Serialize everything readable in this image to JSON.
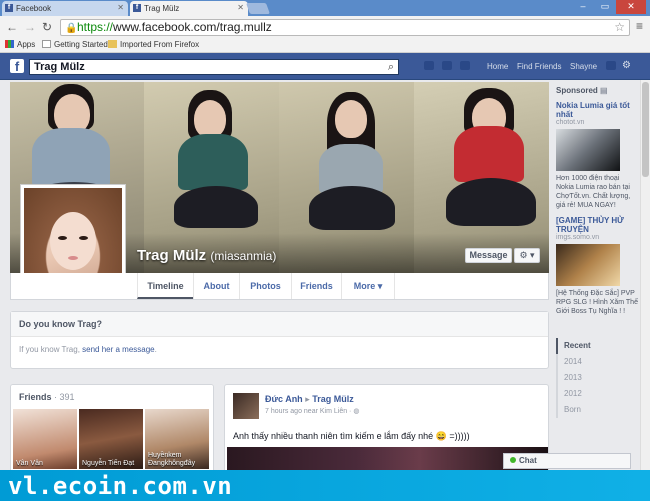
{
  "browser": {
    "tabs": [
      {
        "label": "Facebook",
        "active": false
      },
      {
        "label": "Trag Mülz",
        "active": true
      }
    ],
    "url_scheme": "https://",
    "url_rest": "www.facebook.com/trag.mullz",
    "bookmarks": [
      "Apps",
      "Getting Started",
      "Imported From Firefox"
    ]
  },
  "fb": {
    "search_value": "Trag Mülz",
    "nav": [
      "Home",
      "Find Friends",
      "Shayne"
    ],
    "brand_color": "#3b5998"
  },
  "profile": {
    "name": "Trag Mülz",
    "alt_name": "(miasanmia)",
    "message_label": "Message",
    "gear_label": "⚙ ▾",
    "tabs": [
      "Timeline",
      "About",
      "Photos",
      "Friends",
      "More ▾"
    ]
  },
  "know": {
    "title": "Do you know Trag?",
    "text_prefix": "If you know Trag, ",
    "link": "send her a message",
    "text_suffix": "."
  },
  "friends": {
    "title": "Friends",
    "count": "· 391",
    "people": [
      {
        "caption": "Vân Vân"
      },
      {
        "caption": "Nguyễn Tiến Đạt"
      },
      {
        "caption": "Huyềnkem Đangkhôngđây"
      }
    ]
  },
  "post": {
    "author": "Đức Anh",
    "arrow": "▸",
    "target": "Trag Mülz",
    "meta": "7 hours ago near Kim Liên · ",
    "text": "Anh thấy nhiều thanh niên tìm kiếm e lắm đấy nhé 😄 =)))))"
  },
  "sidebar": {
    "sponsored": "Sponsored",
    "ad1": {
      "title": "Nokia Lumia giá tốt nhất",
      "url": "chotot.vn",
      "body": "Hơn 1000 điện thoại Nokia Lumia rao bán tại ChợTốt.vn. Chất lượng, giá rẻ! MUA NGAY!"
    },
    "ad2": {
      "title": "[GAME] THỦY HỬ TRUYỆN",
      "url": "imgs.somo.vn",
      "body": "[Hệ Thống Đặc Sắc] PVP RPG SLG ! Hình Xăm Thế Giới Boss Tụ Nghĩa ! !"
    },
    "years": [
      "Recent",
      "2014",
      "2013",
      "2012",
      "Born"
    ]
  },
  "chat": {
    "label": "Chat"
  },
  "watermark": "vl.ecoin.com.vn"
}
